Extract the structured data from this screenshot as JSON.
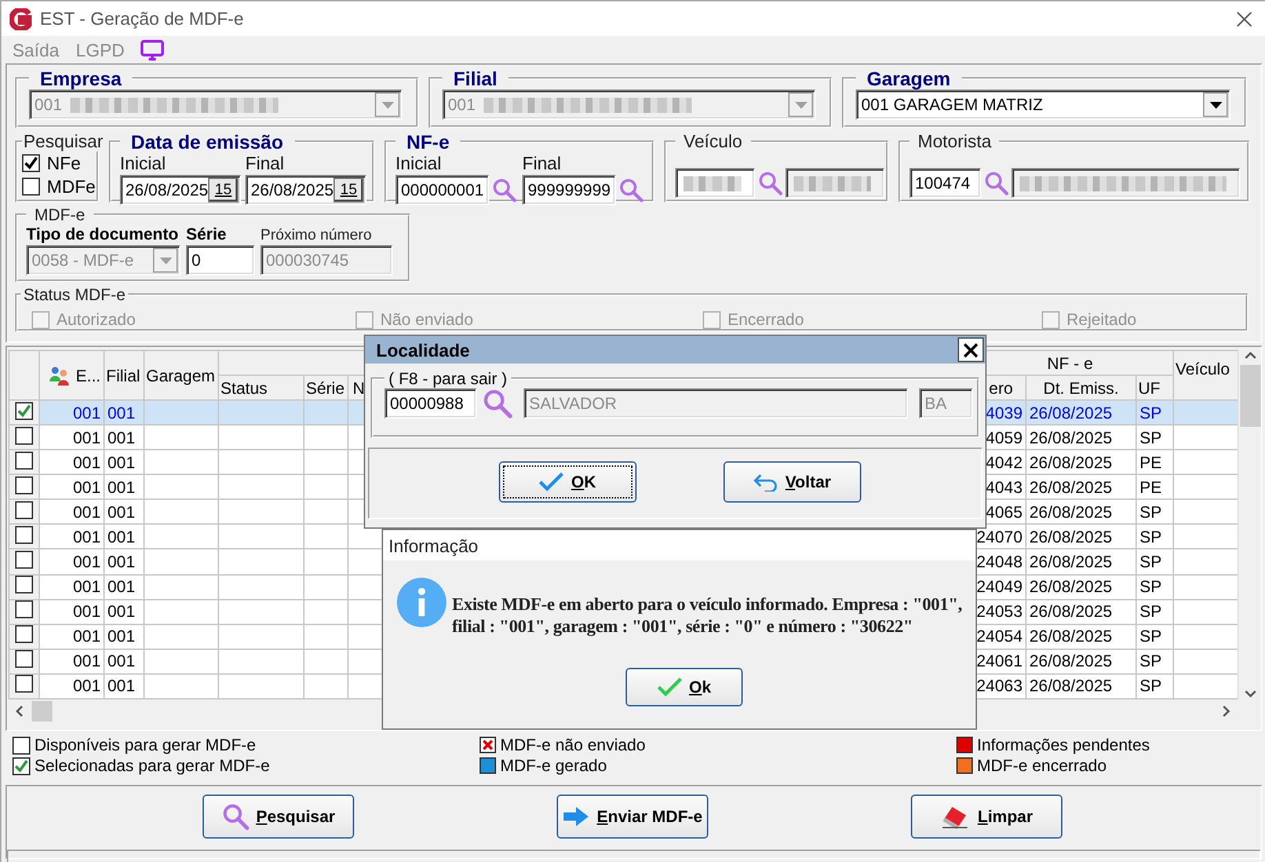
{
  "window": {
    "title": "EST - Geração de MDF-e"
  },
  "menu": [
    {
      "label": "Saída",
      "disabled": true
    },
    {
      "label": "LGPD",
      "disabled": true
    }
  ],
  "empresa": {
    "label": "Empresa",
    "value": "001",
    "redacted": true,
    "disabled": true
  },
  "filial": {
    "label": "Filial",
    "value": "001",
    "redacted": true,
    "disabled": true
  },
  "garagem": {
    "label": "Garagem",
    "value": "001 GARAGEM MATRIZ",
    "disabled": false
  },
  "pesquisar": {
    "label": "Pesquisar",
    "options": [
      {
        "label": "NFe",
        "checked": true
      },
      {
        "label": "MDFe",
        "checked": false
      }
    ]
  },
  "data_emissao": {
    "label": "Data de emissão",
    "fields": [
      {
        "label": "Inicial",
        "value": "26/08/2025",
        "calendar": "15"
      },
      {
        "label": "Final",
        "value": "26/08/2025",
        "calendar": "15"
      }
    ]
  },
  "nfe": {
    "label": "NF-e",
    "fields": [
      {
        "label": "Inicial",
        "value": "000000001"
      },
      {
        "label": "Final",
        "value": "999999999"
      }
    ]
  },
  "veiculo": {
    "label": "Veículo",
    "fields": [
      {
        "redacted": true,
        "disabled": false
      },
      {
        "redacted": true,
        "disabled": true
      }
    ]
  },
  "motorista": {
    "label": "Motorista",
    "fields": [
      {
        "value": "100474",
        "disabled": false
      },
      {
        "redacted": true,
        "disabled": true
      }
    ]
  },
  "mdfe": {
    "label": "MDF-e",
    "tipo": {
      "label": "Tipo de documento",
      "value": "0058 - MDF-e",
      "disabled": true
    },
    "serie": {
      "label": "Série",
      "value": "0",
      "disabled": false
    },
    "proximo": {
      "label": "Próximo número",
      "value": "000030745",
      "disabled": true
    }
  },
  "status_mdfe": {
    "label": "Status MDF-e",
    "options": [
      {
        "label": "Autorizado",
        "checked": false,
        "disabled": true
      },
      {
        "label": "Não enviado",
        "checked": false,
        "disabled": true
      },
      {
        "label": "Encerrado",
        "checked": false,
        "disabled": true
      },
      {
        "label": "Rejeitado",
        "checked": false,
        "disabled": true
      }
    ]
  },
  "table": {
    "group_header": "NF - e",
    "columns": [
      {
        "label": "E..."
      },
      {
        "label": "Filial"
      },
      {
        "label": "Garagem"
      },
      {
        "label": "Status"
      },
      {
        "label": "Série"
      },
      {
        "label": "N"
      },
      {
        "label": "ero"
      },
      {
        "label": "Dt. Emiss."
      },
      {
        "label": "UF"
      },
      {
        "label": "Veículo"
      }
    ],
    "rows": [
      {
        "checked": true,
        "selected": true,
        "empresa": "001",
        "filial": "001",
        "numero": "4039",
        "dt_emiss": "26/08/2025",
        "uf": "SP"
      },
      {
        "checked": false,
        "selected": false,
        "empresa": "001",
        "filial": "001",
        "numero": "4059",
        "dt_emiss": "26/08/2025",
        "uf": "SP"
      },
      {
        "checked": false,
        "selected": false,
        "empresa": "001",
        "filial": "001",
        "numero": "4042",
        "dt_emiss": "26/08/2025",
        "uf": "PE"
      },
      {
        "checked": false,
        "selected": false,
        "empresa": "001",
        "filial": "001",
        "numero": "4043",
        "dt_emiss": "26/08/2025",
        "uf": "PE"
      },
      {
        "checked": false,
        "selected": false,
        "empresa": "001",
        "filial": "001",
        "numero": "4065",
        "dt_emiss": "26/08/2025",
        "uf": "SP"
      },
      {
        "checked": false,
        "selected": false,
        "empresa": "001",
        "filial": "001",
        "numero": "24070",
        "dt_emiss": "26/08/2025",
        "uf": "SP"
      },
      {
        "checked": false,
        "selected": false,
        "empresa": "001",
        "filial": "001",
        "numero": "24048",
        "dt_emiss": "26/08/2025",
        "uf": "SP"
      },
      {
        "checked": false,
        "selected": false,
        "empresa": "001",
        "filial": "001",
        "numero": "24049",
        "dt_emiss": "26/08/2025",
        "uf": "SP"
      },
      {
        "checked": false,
        "selected": false,
        "empresa": "001",
        "filial": "001",
        "numero": "24053",
        "dt_emiss": "26/08/2025",
        "uf": "SP"
      },
      {
        "checked": false,
        "selected": false,
        "empresa": "001",
        "filial": "001",
        "numero": "24054",
        "dt_emiss": "26/08/2025",
        "uf": "SP"
      },
      {
        "checked": false,
        "selected": false,
        "empresa": "001",
        "filial": "001",
        "numero": "24061",
        "dt_emiss": "26/08/2025",
        "uf": "SP"
      },
      {
        "checked": false,
        "selected": false,
        "empresa": "001",
        "filial": "001",
        "numero": "24063",
        "dt_emiss": "26/08/2025",
        "uf": "SP"
      }
    ]
  },
  "legend": [
    {
      "kind": "checkbox",
      "label": "Disponíveis para gerar MDF-e",
      "checked": false
    },
    {
      "kind": "checkbox",
      "label": "Selecionadas para gerar MDF-e",
      "checked": true
    },
    {
      "kind": "cross",
      "label": "MDF-e não enviado"
    },
    {
      "kind": "swatch",
      "label": "MDF-e gerado",
      "color": "#1e90d8"
    },
    {
      "kind": "swatch",
      "label": "Informações pendentes",
      "color": "#e00000"
    },
    {
      "kind": "swatch",
      "label": "MDF-e encerrado",
      "color": "#f07020"
    }
  ],
  "buttons": [
    {
      "kind": "search",
      "label": "Pesquisar"
    },
    {
      "kind": "send",
      "label": "Enviar MDF-e"
    },
    {
      "kind": "clear",
      "label": "Limpar"
    }
  ],
  "localidade_dialog": {
    "title": "Localidade",
    "group": "( F8 - para sair )",
    "fields": [
      {
        "value": "00000988",
        "disabled": false
      },
      {
        "value": "SALVADOR",
        "disabled": true
      },
      {
        "value": "BA",
        "disabled": true
      }
    ],
    "buttons": [
      {
        "kind": "ok",
        "label": "OK",
        "focused": true
      },
      {
        "kind": "back",
        "label": "Voltar",
        "focused": false
      }
    ]
  },
  "info_dialog": {
    "title": "Informação",
    "message": "Existe MDF-e em aberto para o veículo informado. Empresa : \"001\", filial : \"001\", garagem : \"001\", série : \"0\" e número : \"30622\"",
    "button": {
      "kind": "ok",
      "label": "Ok"
    }
  }
}
